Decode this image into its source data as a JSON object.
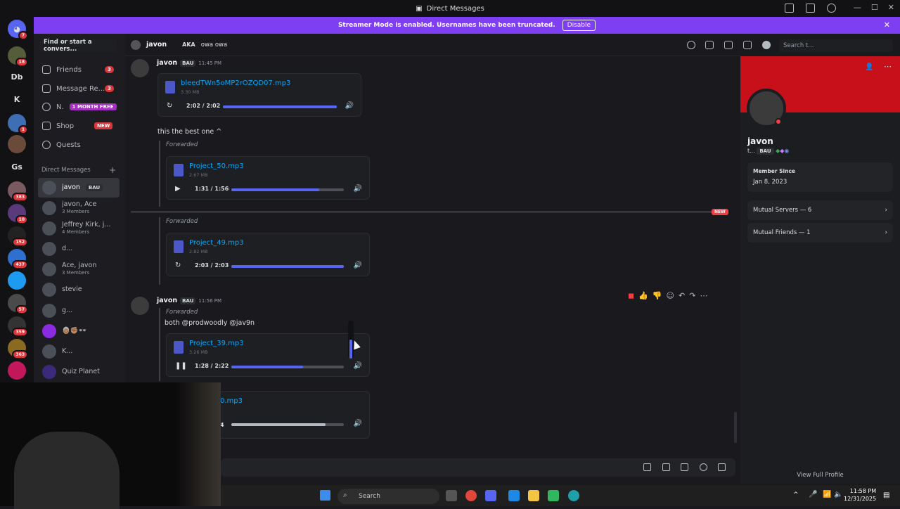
{
  "window": {
    "title": "Direct Messages"
  },
  "banner": {
    "text": "Streamer Mode is enabled. Usernames have been truncated.",
    "disable_label": "Disable"
  },
  "servers": [
    {
      "badge": "18"
    },
    {
      "label": "Db"
    },
    {
      "label": "K"
    },
    {
      "badge": "1"
    },
    {
      "label": ""
    },
    {
      "label": "Gs"
    },
    {
      "badge": "383"
    },
    {
      "badge": "10"
    },
    {
      "badge": "152"
    },
    {
      "badge": "437"
    },
    {
      "badge": ""
    },
    {
      "badge": "57"
    },
    {
      "badge": "359"
    },
    {
      "badge": "363"
    },
    {
      "badge": ""
    }
  ],
  "discord_badge": "7",
  "dm_sidebar": {
    "find_placeholder": "Find or start a convers...",
    "nav": [
      {
        "label": "Friends",
        "badge": "3"
      },
      {
        "label": "Message Re...",
        "badge": "3"
      },
      {
        "label": "N.",
        "tag": "1 MONTH FREE"
      },
      {
        "label": "Shop",
        "tag": "NEW"
      },
      {
        "label": "Quests"
      }
    ],
    "section_label": "Direct Messages",
    "dms": [
      {
        "name": "javon",
        "tag": "BAU",
        "sub": ""
      },
      {
        "name": "javon, Ace",
        "sub": "3 Members"
      },
      {
        "name": "Jeffrey Kirk, j...",
        "sub": "4 Members"
      },
      {
        "name": "d...",
        "sub": ""
      },
      {
        "name": "Ace, javon",
        "sub": "3 Members"
      },
      {
        "name": "stevie",
        "sub": ""
      },
      {
        "name": "g...",
        "sub": ""
      },
      {
        "name": "👵🏽✊🏽👓",
        "sub": ""
      },
      {
        "name": "K...",
        "sub": ""
      },
      {
        "name": "Quiz Planet",
        "sub": ""
      }
    ]
  },
  "chat_header": {
    "name": "javon",
    "aka_label": "AKA",
    "aka_value": "owa owa",
    "search_placeholder": "Search t..."
  },
  "messages": {
    "m1": {
      "author": "javon",
      "tag": "BAU",
      "time": "11:45 PM",
      "file": {
        "name": "bleedTWn5oMP2rOZQD07.mp3",
        "size": "3.30 MB",
        "time": "2:02 / 2:02",
        "progress": 1.0
      },
      "text": "this the best one ^"
    },
    "f1": {
      "forward_label": "Forwarded",
      "file": {
        "name": "Project_50.mp3",
        "size": "2.67 MB",
        "time": "1:31 / 1:56",
        "progress": 0.78
      }
    },
    "new_label": "NEW",
    "f2": {
      "forward_label": "Forwarded",
      "file": {
        "name": "Project_49.mp3",
        "size": "2.82 MB",
        "time": "2:03 / 2:03",
        "progress": 1.0
      }
    },
    "m2": {
      "author": "javon",
      "tag": "BAU",
      "time": "11:56 PM",
      "forward_label": "Forwarded",
      "text": "both @prodwoodly @jav9n",
      "file": {
        "name": "Project_39.mp3",
        "size": "3.26 MB",
        "time": "1:28 / 2:22",
        "progress": 0.64
      }
    },
    "f3": {
      "file": {
        "name": "0.mp3",
        "time": "4",
        "progress": 0.84
      }
    }
  },
  "volume_level": 0.5,
  "profile": {
    "name": "javon",
    "sub": "t...",
    "tag": "BAU",
    "member_since_label": "Member Since",
    "member_since": "Jan 8, 2023",
    "mutual_servers": "Mutual Servers — 6",
    "mutual_friends": "Mutual Friends — 1",
    "view_full": "View Full Profile"
  },
  "taskbar": {
    "search_placeholder": "Search",
    "time": "11:58 PM",
    "date": "12/31/2025"
  },
  "colors": {
    "accent": "#5865f2",
    "banner": "#7e3ff2",
    "profile_banner": "#c7101a",
    "new": "#f23f43"
  }
}
